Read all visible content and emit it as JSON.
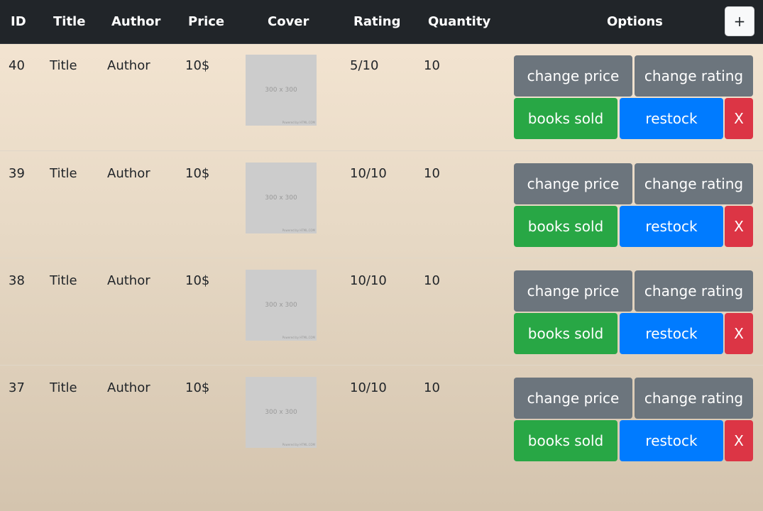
{
  "header": {
    "columns": {
      "id": "ID",
      "title": "Title",
      "author": "Author",
      "price": "Price",
      "cover": "Cover",
      "rating": "Rating",
      "quantity": "Quantity",
      "options": "Options"
    },
    "add_label": "+"
  },
  "buttons": {
    "change_price": "change price",
    "change_rating": "change rating",
    "books_sold": "books sold",
    "restock": "restock",
    "delete": "X"
  },
  "cover_placeholder": {
    "size_text": "300 x 300",
    "credit_text": "Powered by HTML.COM"
  },
  "rows": [
    {
      "id": "40",
      "title": "Title",
      "author": "Author",
      "price": "10$",
      "rating": "5/10",
      "quantity": "10"
    },
    {
      "id": "39",
      "title": "Title",
      "author": "Author",
      "price": "10$",
      "rating": "10/10",
      "quantity": "10"
    },
    {
      "id": "38",
      "title": "Title",
      "author": "Author",
      "price": "10$",
      "rating": "10/10",
      "quantity": "10"
    },
    {
      "id": "37",
      "title": "Title",
      "author": "Author",
      "price": "10$",
      "rating": "10/10",
      "quantity": "10"
    }
  ]
}
